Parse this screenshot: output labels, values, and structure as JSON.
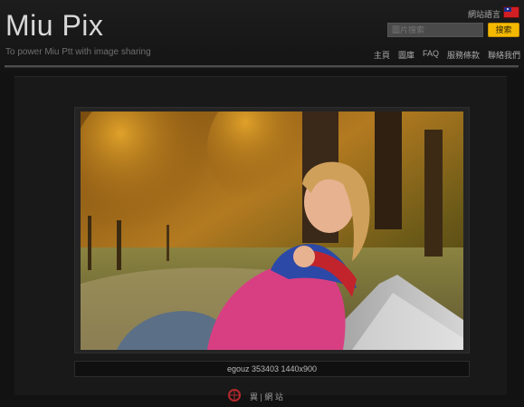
{
  "header": {
    "logo": "Miu Pix",
    "tagline": "To power Miu Ptt with image sharing",
    "language_label": "網站語言",
    "search_placeholder": "圖片搜索",
    "search_button": "搜索"
  },
  "nav": {
    "items": [
      "主頁",
      "圖庫",
      "FAQ",
      "服務條款",
      "聯絡我們"
    ]
  },
  "image": {
    "caption": "egouz 353403 1440x900"
  },
  "footer": {
    "watermark": "異 | 網 站"
  }
}
